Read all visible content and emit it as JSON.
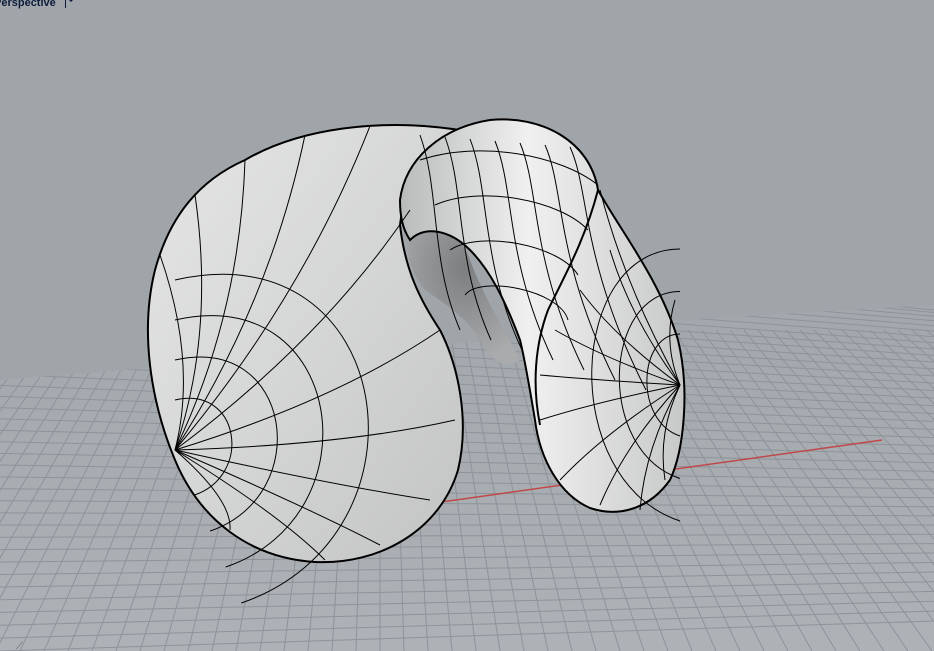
{
  "viewport": {
    "name": "Perspective",
    "menu_icon": "chevron-down-icon",
    "axis_indicator": "axes-gizmo-icon"
  },
  "colors": {
    "background": "#a0a5aa",
    "grid": "#8e939a",
    "x_axis": "#c0484a",
    "surface": "#dadbdb",
    "isocurve": "#000000"
  },
  "scene": {
    "object": "surface",
    "display_mode": "shaded",
    "grid": true
  }
}
